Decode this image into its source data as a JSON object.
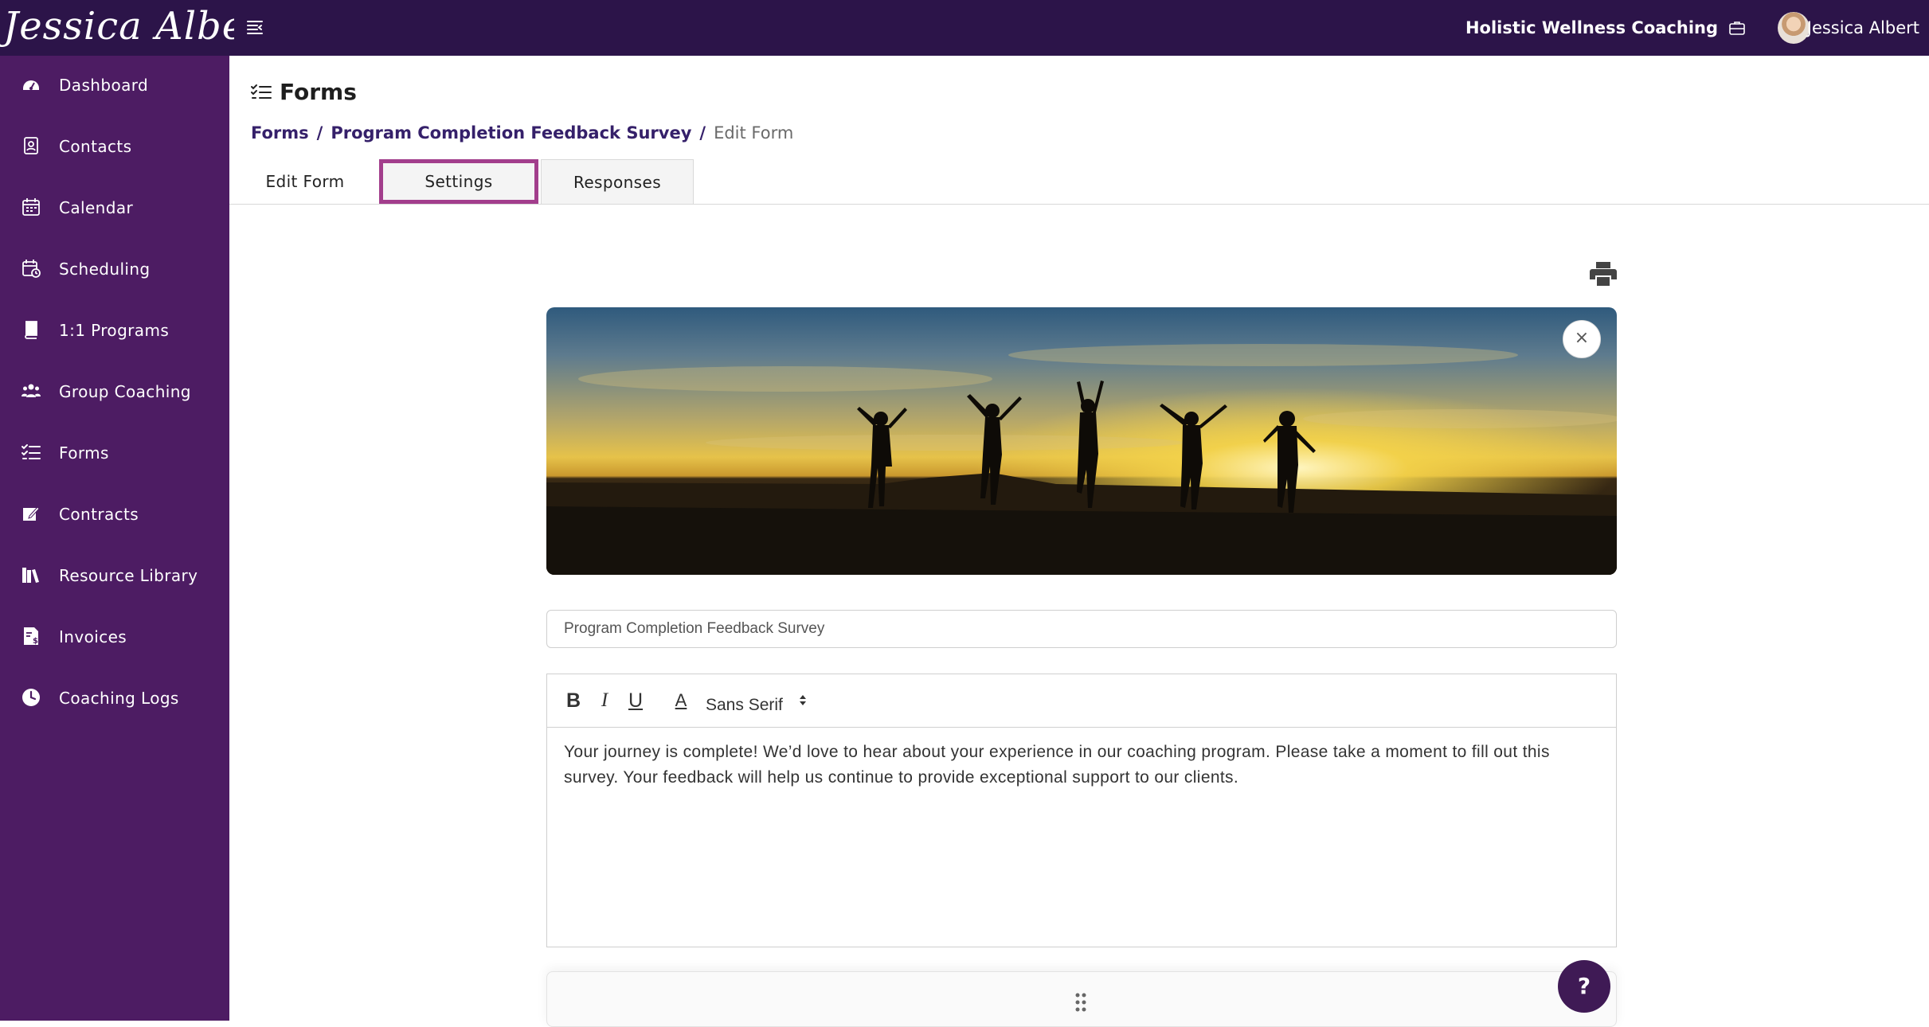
{
  "topbar": {
    "logo_text": "Jessica Albert",
    "org_name": "Holistic Wellness Coaching",
    "user_name": "Jessica Albert"
  },
  "sidebar": {
    "items": [
      {
        "label": "Dashboard",
        "icon": "dashboard-icon"
      },
      {
        "label": "Contacts",
        "icon": "contacts-icon"
      },
      {
        "label": "Calendar",
        "icon": "calendar-icon"
      },
      {
        "label": "Scheduling",
        "icon": "scheduling-icon"
      },
      {
        "label": "1:1 Programs",
        "icon": "book-icon"
      },
      {
        "label": "Group Coaching",
        "icon": "group-icon"
      },
      {
        "label": "Forms",
        "icon": "forms-icon"
      },
      {
        "label": "Contracts",
        "icon": "contract-icon"
      },
      {
        "label": "Resource Library",
        "icon": "library-icon"
      },
      {
        "label": "Invoices",
        "icon": "invoice-icon"
      },
      {
        "label": "Coaching Logs",
        "icon": "clock-icon"
      }
    ]
  },
  "page": {
    "title": "Forms",
    "breadcrumb": {
      "root": "Forms",
      "parent": "Program Completion Feedback Survey",
      "current": "Edit Form"
    },
    "tabs": [
      {
        "label": "Edit Form"
      },
      {
        "label": "Settings"
      },
      {
        "label": "Responses"
      }
    ]
  },
  "form": {
    "title_value": "Program Completion Feedback Survey",
    "banner_close": "×",
    "editor": {
      "bold": "B",
      "italic": "I",
      "underline": "U",
      "color": "A",
      "font_family": "Sans Serif",
      "body": "Your journey is complete! We’d love to hear about your experience in our coaching program. Please take a moment to fill out this survey. Your feedback will help us continue to provide exceptional support to our clients."
    }
  },
  "help": {
    "label": "?"
  },
  "colors": {
    "topbar_bg": "#2c1449",
    "sidebar_bg": "#4d1c63",
    "link": "#35206a",
    "highlight_border": "#a23e8c",
    "help_bg": "#3f1a55"
  }
}
